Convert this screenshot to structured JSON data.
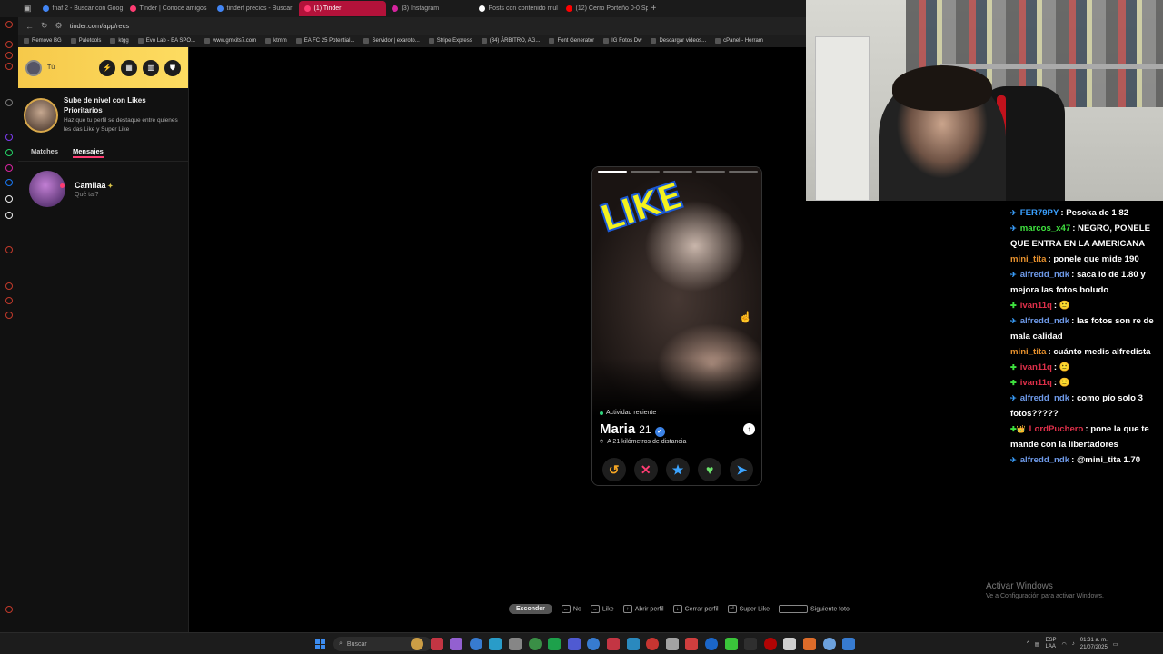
{
  "browser": {
    "tabs": [
      {
        "label": "fnaf 2 - Buscar con Goog",
        "color": "#4285f4"
      },
      {
        "label": "Tinder | Conoce amigos",
        "color": "#fe3c72"
      },
      {
        "label": "tinderf precios - Buscar",
        "color": "#4285f4"
      },
      {
        "label": "(1) Tinder",
        "color": "#fe3c72",
        "active": true
      },
      {
        "label": "(3) Instagram",
        "color": "#d6249f"
      },
      {
        "label": "Posts con contenido mul",
        "color": "#ffffff"
      },
      {
        "label": "(12) Cerro Porteño 0-0 Sp",
        "color": "#ff0000"
      }
    ],
    "new_tab": "+",
    "url": "tinder.com/app/recs",
    "bookmarks": [
      "Remove BG",
      "Paletools",
      "ktgg",
      "Evo Lab - EA SPO...",
      "www.gmkits7.com",
      "ktmm",
      "EA FC 25 Potential...",
      "Servidor | exaroto...",
      "Stripe Express",
      "(34) ÁRBITRO, AG...",
      "Font Generator",
      "IG Fotos Dw",
      "Descargar videos...",
      "cPanel - Herram"
    ]
  },
  "sidebar": {
    "user_label": "Tú",
    "promo_title": "Sube de nivel con Likes Prioritarios",
    "promo_text": "Haz que tu perfil se destaque entre quienes les das Like y Super Like",
    "tabs": [
      "Matches",
      "Mensajes"
    ],
    "active_tab": "Mensajes",
    "conversations": [
      {
        "name": "Camilaa",
        "preview": "Qué tal?"
      }
    ]
  },
  "card": {
    "sticker": "LIKE",
    "activity": "Actividad reciente",
    "name": "Maria",
    "age": "21",
    "distance": "A 21 kilómetros de distancia",
    "photo_count": 5,
    "current_photo": 1,
    "colors": {
      "rewind": "#f5a623",
      "nope": "#fe3c72",
      "superlike": "#3ca4ff",
      "like": "#6ce36c",
      "boost": "#3ca4ff"
    }
  },
  "hints": {
    "hide": "Esconder",
    "items": [
      "No",
      "Like",
      "Abrir perfil",
      "Cerrar perfil",
      "Super Like",
      "Siguiente foto"
    ]
  },
  "watermark": {
    "title": "Activar Windows",
    "subtitle": "Ve a Configuración para activar Windows."
  },
  "chat": [
    {
      "badge": "✈",
      "badge_color": "#3aa0ff",
      "user": "FER79PY",
      "color": "#3aa0ff",
      "text": ": Pesoka de 1 82"
    },
    {
      "badge": "✈",
      "badge_color": "#3aa0ff",
      "user": "marcos_x47",
      "color": "#3fe33f",
      "text": ": NEGRO, PONELE QUE ENTRA EN LA AMERICANA"
    },
    {
      "badge": "",
      "badge_color": "",
      "user": "mini_tita",
      "color": "#e8912d",
      "text": ": ponele que mide 190"
    },
    {
      "badge": "✈",
      "badge_color": "#3aa0ff",
      "user": "alfredd_ndk",
      "color": "#6f9bea",
      "text": ": saca lo de 1.80 y mejora las fotos boludo"
    },
    {
      "badge": "✚",
      "badge_color": "#3fe33f",
      "user": "ivan11q",
      "color": "#e0304a",
      "text": ": 🙂"
    },
    {
      "badge": "✈",
      "badge_color": "#3aa0ff",
      "user": "alfredd_ndk",
      "color": "#6f9bea",
      "text": ": las fotos son re de mala calidad"
    },
    {
      "badge": "",
      "badge_color": "",
      "user": "mini_tita",
      "color": "#e8912d",
      "text": ": cuánto medis alfredista"
    },
    {
      "badge": "✚",
      "badge_color": "#3fe33f",
      "user": "ivan11q",
      "color": "#e0304a",
      "text": ": 🙂"
    },
    {
      "badge": "✚",
      "badge_color": "#3fe33f",
      "user": "ivan11q",
      "color": "#e0304a",
      "text": ": 🙂"
    },
    {
      "badge": "✈",
      "badge_color": "#3aa0ff",
      "user": "alfredd_ndk",
      "color": "#6f9bea",
      "text": ": como pío solo 3 fotos?????"
    },
    {
      "badge": "✚👑",
      "badge_color": "#3fe33f",
      "user": "LordPuchero",
      "color": "#e0304a",
      "text": ": pone la que te mande con la libertadores"
    },
    {
      "badge": "✈",
      "badge_color": "#3aa0ff",
      "user": "alfredd_ndk",
      "color": "#6f9bea",
      "text": ": @mini_tita 1.70"
    }
  ],
  "taskbar": {
    "search_placeholder": "Buscar",
    "lang": "ESP\nLAA",
    "time": "01:31 a. m.",
    "date": "21/07/2025",
    "apps": [
      "#e8b14a",
      "#e0394a",
      "#a86cf0",
      "#3c8cf0",
      "#2bb3e8",
      "#999",
      "#3fa34d",
      "#1db954",
      "#5865f2",
      "#3c8cf0",
      "#e0394a",
      "#2d9cdb",
      "#e53935",
      "#bbb",
      "#e44",
      "#1b73e8",
      "#3fe33f",
      "#333",
      "#c00",
      "#eee",
      "#ff7a2d",
      "#7ab8ff",
      "#3c8cf0"
    ]
  }
}
